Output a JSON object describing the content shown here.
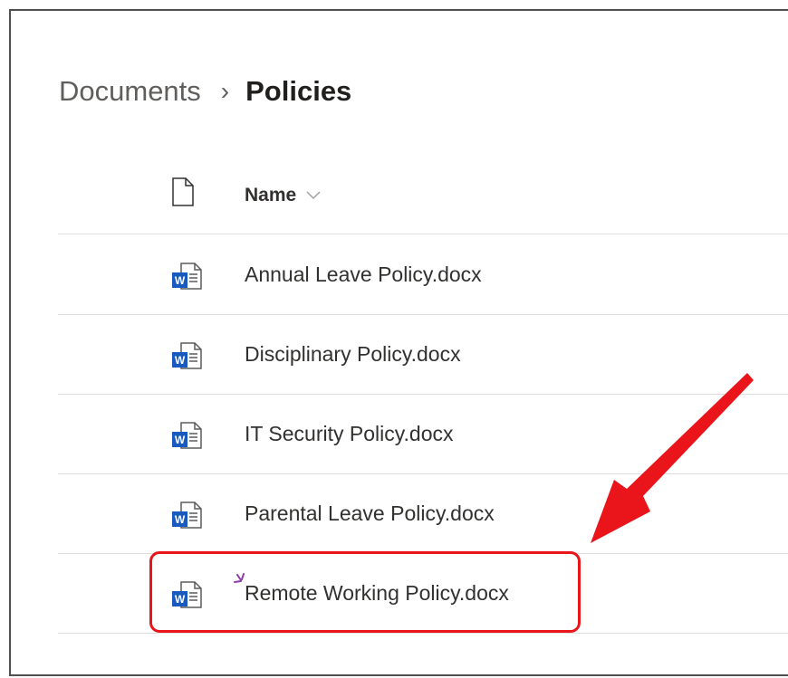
{
  "breadcrumb": {
    "root": "Documents",
    "separator": "›",
    "current": "Policies"
  },
  "list": {
    "column_header": "Name",
    "files": [
      {
        "name": "Annual Leave Policy.docx",
        "type": "word"
      },
      {
        "name": "Disciplinary Policy.docx",
        "type": "word"
      },
      {
        "name": "IT Security Policy.docx",
        "type": "word"
      },
      {
        "name": "Parental Leave Policy.docx",
        "type": "word"
      },
      {
        "name": "Remote Working Policy.docx",
        "type": "word",
        "new": true,
        "highlighted": true
      }
    ]
  },
  "colors": {
    "highlight": "#e9151b",
    "word_blue": "#185abd",
    "new_indicator": "#8a3ea7"
  }
}
